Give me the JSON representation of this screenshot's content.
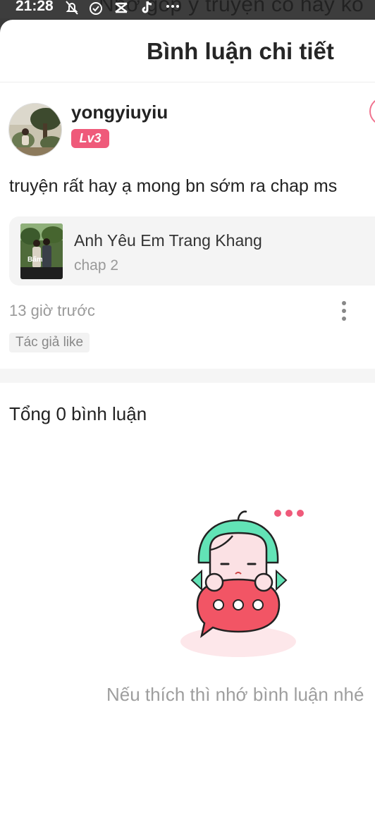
{
  "status_bar": {
    "time": "21:28",
    "overlay_text": "Nhờ góp ý truyện có hay ko",
    "icons": [
      "bell-off-icon",
      "alarm-icon",
      "capcut-icon",
      "tiktok-icon",
      "more-dots-icon"
    ]
  },
  "header": {
    "title": "Bình luận chi tiết"
  },
  "comment": {
    "username": "yongyiuyiu",
    "level": "Lv3",
    "text": "truyện rất hay ạ mong bn sớm ra chap ms",
    "story": {
      "title": "Anh Yêu Em Trang Khang",
      "chapter": "chap 2",
      "thumb_text": "Bấm"
    },
    "timestamp": "13 giờ trước",
    "author_like": "Tác giả like"
  },
  "replies": {
    "total_label": "Tổng 0 bình luận",
    "empty_message": "Nếu thích thì nhớ bình luận nhé"
  },
  "colors": {
    "accent": "#ef5a7a",
    "mascot_hair": "#62e3b6",
    "bubble": "#f25565"
  }
}
